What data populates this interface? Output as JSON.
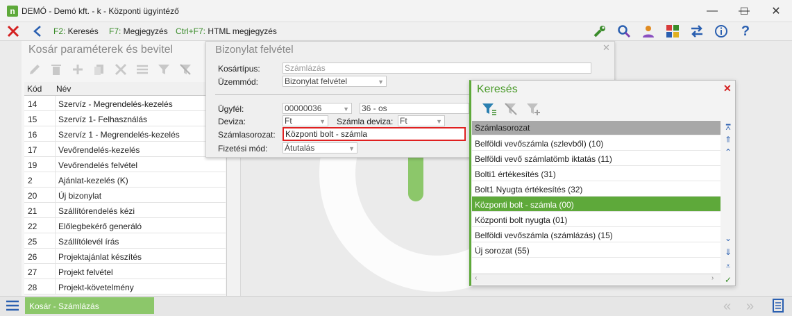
{
  "window": {
    "title": "DEMÓ - Demó kft. - k - Központi ügyintéző",
    "minimize": "—",
    "maximize": "☐",
    "close": "✕"
  },
  "toolbar": {
    "f2_key": "F2:",
    "f2_label": " Keresés",
    "f7_key": "F7:",
    "f7_label": " Megjegyzés",
    "ctrlf7_key": "Ctrl+F7:",
    "ctrlf7_label": " HTML megjegyzés"
  },
  "left_panel": {
    "title": "Kosár paraméterek és bevitel",
    "columns": [
      "Kód",
      "Név"
    ],
    "rows": [
      {
        "code": "14",
        "name": "Szervíz - Megrendelés-kezelés"
      },
      {
        "code": "15",
        "name": "Szervíz 1- Felhasználás"
      },
      {
        "code": "16",
        "name": "Szervíz 1 - Megrendelés-kezelés"
      },
      {
        "code": "17",
        "name": "Vevőrendelés-kezelés"
      },
      {
        "code": "19",
        "name": "Vevőrendelés felvétel"
      },
      {
        "code": "2",
        "name": "Ajánlat-kezelés (K)"
      },
      {
        "code": "20",
        "name": "Új bizonylat"
      },
      {
        "code": "21",
        "name": "Szállítórendelés kézi"
      },
      {
        "code": "22",
        "name": "Előlegbekérő generáló"
      },
      {
        "code": "25",
        "name": "Szállítólevél írás"
      },
      {
        "code": "26",
        "name": "Projektajánlat készítés"
      },
      {
        "code": "27",
        "name": "Projekt felvétel"
      },
      {
        "code": "28",
        "name": "Projekt-követelmény"
      }
    ]
  },
  "dialog": {
    "title": "Bizonylat felvétel",
    "kosartipus_label": "Kosártípus:",
    "kosartipus_value": "Számlázás",
    "uzemmod_label": "Üzemmód:",
    "uzemmod_value": "Bizonylat felvétel",
    "ugyfel_label": "Ügyfél:",
    "ugyfel_code": "00000036",
    "ugyfel_name": "36 - os",
    "deviza_label": "Deviza:",
    "deviza_value": "Ft",
    "szamla_deviza_label": "Számla deviza:",
    "szamla_deviza_value": "Ft",
    "szamlasorozat_label": "Számlasorozat:",
    "szamlasorozat_value": "Központi bolt - számla",
    "fizetesi_mod_label": "Fizetési mód:",
    "fizetesi_mod_value": "Átutalás"
  },
  "search": {
    "title": "Keresés",
    "column": "Számlasorozat",
    "items": [
      "Belföldi vevőszámla (szlevből) (10)",
      "Belföldi vevő számlatömb iktatás (11)",
      "Bolti1 értékesítés (31)",
      "Bolt1 Nyugta értékesítés (32)",
      "Központi bolt - számla (00)",
      "Központi bolt nyugta (01)",
      "Belföldi vevőszámla (számlázás) (15)",
      "Új sorozat (55)"
    ],
    "selected_index": 4
  },
  "status": {
    "tab_label": "Kosár - Számlázás"
  },
  "colors": {
    "accent": "#5ea93a",
    "highlight_border": "#e02020",
    "icon_blue": "#2a5fb0"
  }
}
